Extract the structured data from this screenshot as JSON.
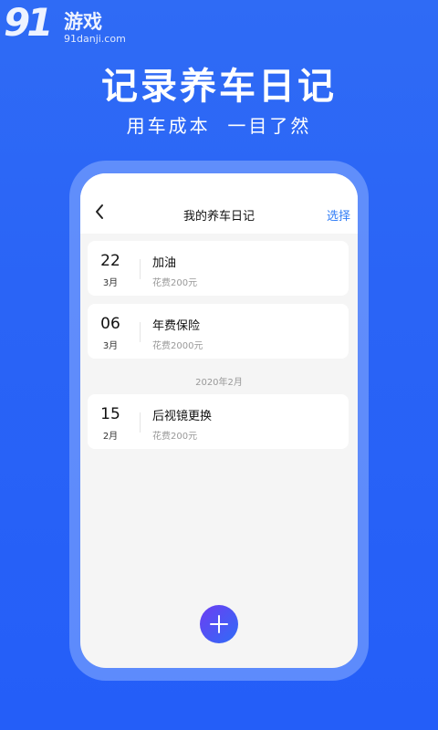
{
  "watermark": {
    "number": "91",
    "text": "游戏",
    "url": "91danji.com"
  },
  "hero": {
    "title": "记录养车日记",
    "subtitle": "用车成本  一目了然"
  },
  "nav": {
    "back_icon": "chevron-left-icon",
    "title": "我的养车日记",
    "action": "选择"
  },
  "entries": [
    {
      "day": "22",
      "month": "3月",
      "title": "加油",
      "cost": "花费200元"
    },
    {
      "day": "06",
      "month": "3月",
      "title": "年费保险",
      "cost": "花费2000元"
    },
    {
      "day": "15",
      "month": "2月",
      "title": "后视镜更换",
      "cost": "花费200元"
    }
  ],
  "section_header": "2020年2月",
  "fab": {
    "icon": "plus-icon"
  },
  "colors": {
    "background": "#2a64f6",
    "accent": "#2f7cf6",
    "fab_start": "#6d3df2",
    "fab_end": "#2f6cf7"
  }
}
